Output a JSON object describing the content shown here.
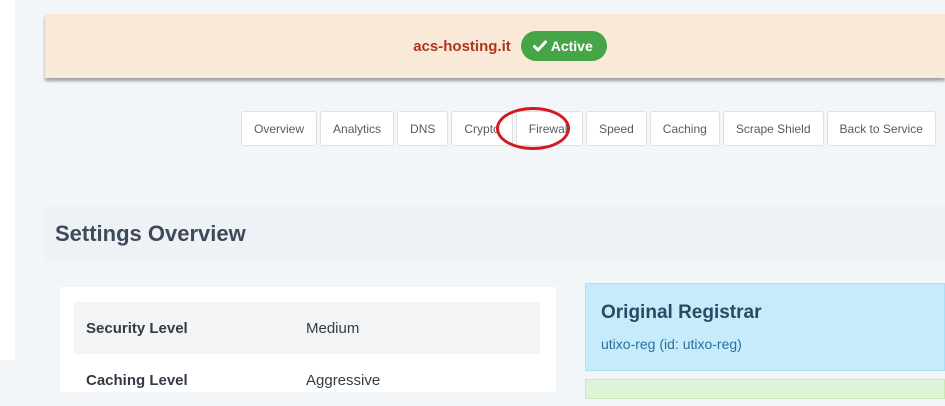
{
  "banner": {
    "domain": "acs-hosting.it",
    "status": "Active",
    "status_icon": "check-icon",
    "colors": {
      "background": "#f9ead7",
      "domain": "#b0351f",
      "badge": "#46a546"
    }
  },
  "tabs": [
    {
      "label": "Overview"
    },
    {
      "label": "Analytics"
    },
    {
      "label": "DNS"
    },
    {
      "label": "Crypto"
    },
    {
      "label": "Firewall",
      "highlighted": true
    },
    {
      "label": "Speed"
    },
    {
      "label": "Caching"
    },
    {
      "label": "Scrape Shield"
    },
    {
      "label": "Back to Service"
    }
  ],
  "settings": {
    "title": "Settings Overview",
    "rows": [
      {
        "label": "Security Level",
        "value": "Medium"
      },
      {
        "label": "Caching Level",
        "value": "Aggressive"
      }
    ]
  },
  "registrar": {
    "title": "Original Registrar",
    "value": "utixo-reg (id: utixo-reg)"
  }
}
